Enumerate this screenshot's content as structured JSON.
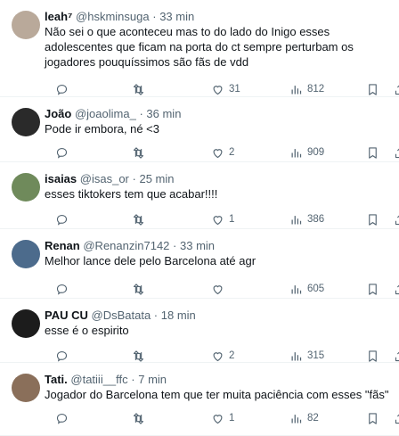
{
  "tweets": [
    {
      "name": "leah⁷",
      "handle": "@hskminsuga",
      "sep": "·",
      "time": "33 min",
      "text": "Não sei o que aconteceu mas to do lado do Inigo esses adolescentes que ficam na porta do ct sempre perturbam os jogadores pouquíssimos são fãs de vdd",
      "replies": "",
      "retweets": "",
      "likes": "31",
      "views": "812",
      "avatar_color": "#b9a99a"
    },
    {
      "name": "João",
      "handle": "@joaolima_",
      "sep": "·",
      "time": "36 min",
      "text": "Pode ir embora, né <3",
      "replies": "",
      "retweets": "",
      "likes": "2",
      "views": "909",
      "avatar_color": "#2a2a2a"
    },
    {
      "name": "isaias",
      "handle": "@isas_or",
      "sep": "·",
      "time": "25 min",
      "text": "esses tiktokers tem que acabar!!!!",
      "replies": "",
      "retweets": "",
      "likes": "1",
      "views": "386",
      "avatar_color": "#6f8a5b"
    },
    {
      "name": "Renan",
      "handle": "@Renanzin7142",
      "sep": "·",
      "time": "33 min",
      "text": "Melhor lance dele pelo Barcelona até agr",
      "replies": "",
      "retweets": "",
      "likes": "",
      "views": "605",
      "avatar_color": "#4c6b8c"
    },
    {
      "name": "PAU CU",
      "handle": "@DsBatata",
      "sep": "·",
      "time": "18 min",
      "text": "esse é o espirito",
      "replies": "",
      "retweets": "",
      "likes": "2",
      "views": "315",
      "avatar_color": "#1c1c1c"
    },
    {
      "name": "Tati.",
      "handle": "@tatiii__ffc",
      "sep": "·",
      "time": "7 min",
      "text": "Jogador do Barcelona tem que ter muita paciência com esses \"fãs\"",
      "replies": "",
      "retweets": "",
      "likes": "1",
      "views": "82",
      "avatar_color": "#8a6f5a"
    }
  ],
  "icons": {
    "reply": "reply-icon",
    "retweet": "retweet-icon",
    "like": "heart-icon",
    "views": "views-icon",
    "bookmark": "bookmark-icon",
    "share": "share-icon"
  }
}
